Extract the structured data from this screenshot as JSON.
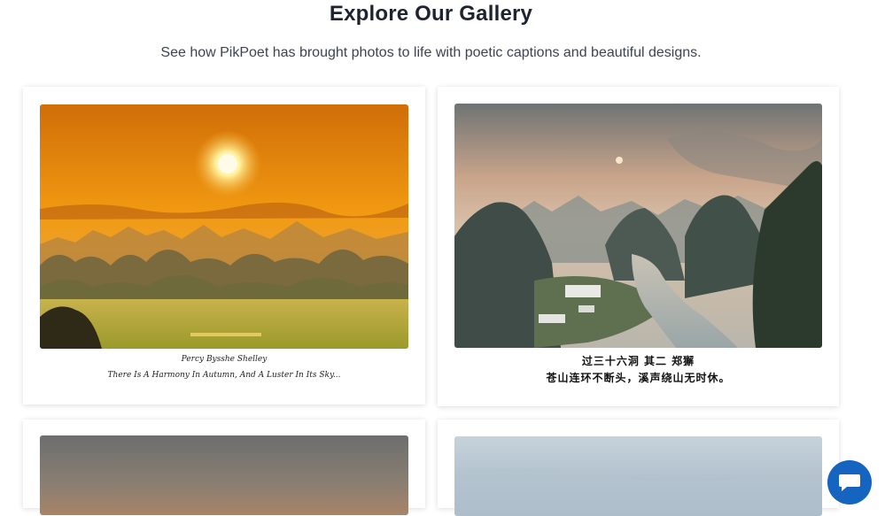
{
  "header": {
    "title": "Explore Our Gallery",
    "subtitle": "See how PikPoet has brought photos to life with poetic captions and beautiful designs."
  },
  "gallery": {
    "cards": [
      {
        "caption_author": "Percy Bysshe Shelley",
        "caption_text": "There Is A Harmony In Autumn, And A Luster In Its Sky..."
      },
      {
        "caption_author": "过三十六洞 其二 郑獬",
        "caption_text": "苍山连环不断头，溪声绕山无时休。"
      },
      {},
      {}
    ]
  },
  "chat_button": {
    "icon": "chat-bubble-icon",
    "color": "#1565c0"
  }
}
